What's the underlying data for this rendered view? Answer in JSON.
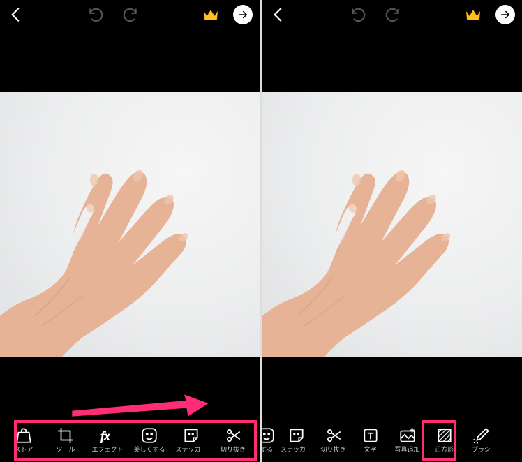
{
  "accent": "#ff2d77",
  "screens": {
    "left": {
      "topbar": [
        "back",
        "undo",
        "redo",
        "crown",
        "forward"
      ],
      "tools": [
        {
          "id": "store",
          "icon": "bag",
          "label": "ストア"
        },
        {
          "id": "tool",
          "icon": "crop",
          "label": "ツール"
        },
        {
          "id": "effect",
          "icon": "fx",
          "label": "エフェクト"
        },
        {
          "id": "beauty",
          "icon": "face",
          "label": "美しくする"
        },
        {
          "id": "sticker",
          "icon": "sticker",
          "label": "ステッカー"
        },
        {
          "id": "cutout",
          "icon": "scissors",
          "label": "切り抜き"
        }
      ],
      "highlight": "all"
    },
    "right": {
      "topbar": [
        "back",
        "undo",
        "redo",
        "crown",
        "forward"
      ],
      "tools": [
        {
          "id": "beauty2",
          "icon": "face",
          "label": "する"
        },
        {
          "id": "sticker",
          "icon": "sticker",
          "label": "ステッカー"
        },
        {
          "id": "cutout",
          "icon": "scissors",
          "label": "切り抜き"
        },
        {
          "id": "text",
          "icon": "text",
          "label": "文字"
        },
        {
          "id": "addphoto",
          "icon": "addphoto",
          "label": "写真追加"
        },
        {
          "id": "square",
          "icon": "square",
          "label": "正方形"
        },
        {
          "id": "brush",
          "icon": "brush",
          "label": "ブラシ"
        }
      ],
      "highlight": "addphoto"
    }
  },
  "photo_description": "open left hand, palm facing camera, fingers spread, against off-white background"
}
